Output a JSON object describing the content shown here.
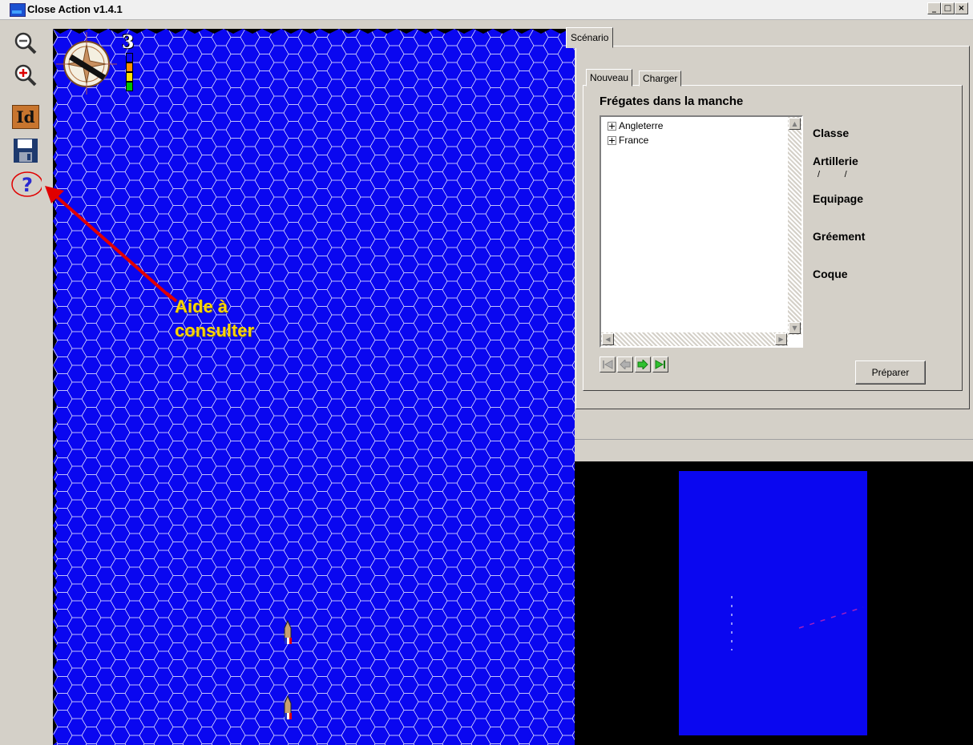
{
  "window": {
    "title": "Close Action v1.4.1",
    "controls": [
      "_",
      "□",
      "×"
    ]
  },
  "toolbar": {
    "tools": [
      "zoom-out",
      "zoom-in",
      "id",
      "save",
      "help"
    ],
    "id_label": "Id",
    "help_label": "?"
  },
  "map": {
    "color": "#0a07f0",
    "wind_strength": "3",
    "annotation": {
      "line1": "Aide à",
      "line2": "consulter",
      "color": "#ffd400",
      "arrow_color": "#e00000"
    }
  },
  "panel": {
    "main_tab": "Scénario",
    "subtabs": [
      "Nouveau",
      "Charger"
    ],
    "group_title": "Frégates dans la manche",
    "tree_items": [
      "Angleterre",
      "France"
    ],
    "labels": {
      "classe": "Classe",
      "artillerie": "Artillerie",
      "artillerie_values": "/          /",
      "equipage": "Equipage",
      "greement": "Gréement",
      "coque": "Coque"
    },
    "prepare_button": "Préparer"
  }
}
